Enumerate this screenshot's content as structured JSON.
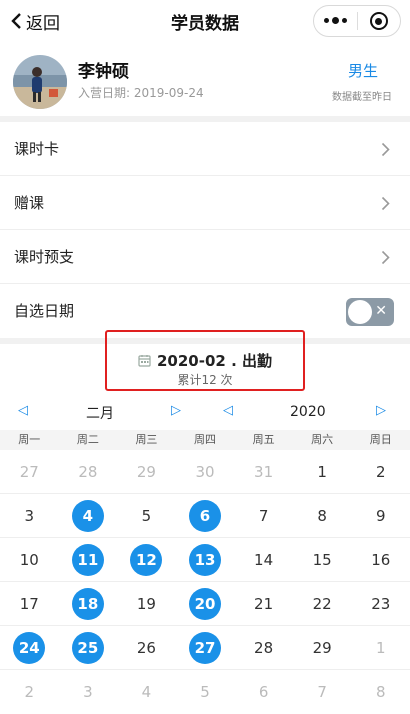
{
  "nav": {
    "back_label": "返回",
    "title": "学员数据"
  },
  "profile": {
    "name": "李钟硕",
    "enroll_label": "入营日期: 2019-09-24",
    "gender": "男生",
    "data_note": "数据截至昨日"
  },
  "menu": [
    {
      "label": "课时卡"
    },
    {
      "label": "赠课"
    },
    {
      "label": "课时预支"
    }
  ],
  "custom_date": {
    "label": "自选日期",
    "toggle_on": false
  },
  "summary": {
    "title": "2020-02 . 出勤",
    "subtitle": "累计12 次"
  },
  "calendar": {
    "month_label": "二月",
    "year_label": "2020",
    "prev_arrow": "◁",
    "next_arrow": "▷",
    "weekdays": [
      "周一",
      "周二",
      "周三",
      "周四",
      "周五",
      "周六",
      "周日"
    ],
    "weeks": [
      [
        {
          "d": "27",
          "m": 1
        },
        {
          "d": "28",
          "m": 1
        },
        {
          "d": "29",
          "m": 1
        },
        {
          "d": "30",
          "m": 1
        },
        {
          "d": "31",
          "m": 1
        },
        {
          "d": "1"
        },
        {
          "d": "2"
        }
      ],
      [
        {
          "d": "3"
        },
        {
          "d": "4",
          "a": 1
        },
        {
          "d": "5"
        },
        {
          "d": "6",
          "a": 1
        },
        {
          "d": "7"
        },
        {
          "d": "8"
        },
        {
          "d": "9"
        }
      ],
      [
        {
          "d": "10"
        },
        {
          "d": "11",
          "a": 1
        },
        {
          "d": "12",
          "a": 1
        },
        {
          "d": "13",
          "a": 1
        },
        {
          "d": "14"
        },
        {
          "d": "15"
        },
        {
          "d": "16"
        }
      ],
      [
        {
          "d": "17"
        },
        {
          "d": "18",
          "a": 1
        },
        {
          "d": "19"
        },
        {
          "d": "20",
          "a": 1
        },
        {
          "d": "21"
        },
        {
          "d": "22"
        },
        {
          "d": "23"
        }
      ],
      [
        {
          "d": "24",
          "a": 1
        },
        {
          "d": "25",
          "a": 1
        },
        {
          "d": "26"
        },
        {
          "d": "27",
          "a": 1
        },
        {
          "d": "28"
        },
        {
          "d": "29"
        },
        {
          "d": "1",
          "m": 1
        }
      ],
      [
        {
          "d": "2",
          "m": 1
        },
        {
          "d": "3",
          "m": 1
        },
        {
          "d": "4",
          "m": 1
        },
        {
          "d": "5",
          "m": 1
        },
        {
          "d": "6",
          "m": 1
        },
        {
          "d": "7",
          "m": 1
        },
        {
          "d": "8",
          "m": 1
        }
      ]
    ]
  },
  "colors": {
    "accent": "#1a91e8",
    "highlight_box": "#e02020"
  }
}
